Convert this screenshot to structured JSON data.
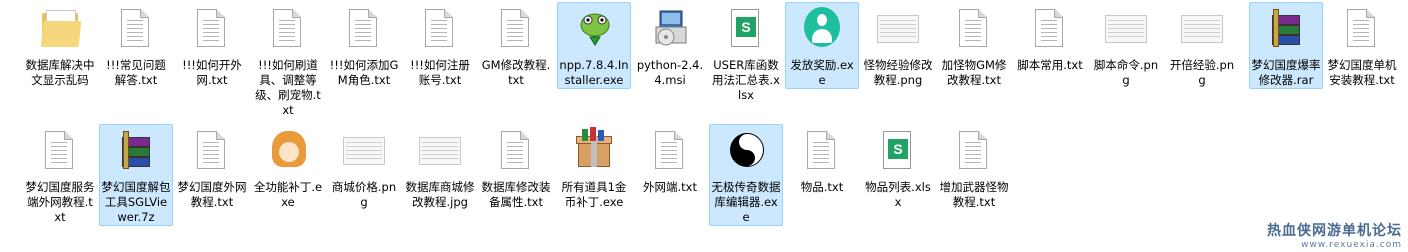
{
  "window": {
    "title": ""
  },
  "colors": {
    "selection_bg": "#cce8ff",
    "selection_border": "#99d1ff",
    "xlsx_green": "#21a366",
    "watermark": "#4a6b8f"
  },
  "files": [
    {
      "name": "数据库解决中文显示乱码",
      "icon": "folder-icon",
      "selected": false
    },
    {
      "name": "!!!常见问题解答.txt",
      "icon": "text-file-icon",
      "selected": false
    },
    {
      "name": "!!!如何开外网.txt",
      "icon": "text-file-icon",
      "selected": false
    },
    {
      "name": "!!!如何刷道具、调整等级、刷宠物.txt",
      "icon": "text-file-icon",
      "selected": false
    },
    {
      "name": "!!!如何添加GM角色.txt",
      "icon": "text-file-icon",
      "selected": false
    },
    {
      "name": "!!!如何注册账号.txt",
      "icon": "text-file-icon",
      "selected": false
    },
    {
      "name": "GM修改教程.txt",
      "icon": "text-file-icon",
      "selected": false
    },
    {
      "name": "npp.7.8.4.Installer.exe",
      "icon": "notepad-frog-icon",
      "selected": true
    },
    {
      "name": "python-2.4.4.msi",
      "icon": "installer-disc-icon",
      "selected": false
    },
    {
      "name": "USER库函数用法汇总表.xlsx",
      "icon": "excel-file-icon",
      "selected": false
    },
    {
      "name": "发放奖励.exe",
      "icon": "person-app-icon",
      "selected": true
    },
    {
      "name": "怪物经验修改教程.png",
      "icon": "image-thumbnail-icon",
      "selected": false
    },
    {
      "name": "加怪物GM修改教程.txt",
      "icon": "text-file-icon",
      "selected": false
    },
    {
      "name": "脚本常用.txt",
      "icon": "text-file-icon",
      "selected": false
    },
    {
      "name": "脚本命令.png",
      "icon": "image-thumbnail-icon",
      "selected": false
    },
    {
      "name": "开倍经验.png",
      "icon": "image-thumbnail-icon",
      "selected": false
    },
    {
      "name": "梦幻国度爆率修改器.rar",
      "icon": "winrar-archive-icon",
      "selected": true
    },
    {
      "name": "梦幻国度单机安装教程.txt",
      "icon": "text-file-icon",
      "selected": false
    },
    {
      "name": "梦幻国度服务端外网教程.txt",
      "icon": "text-file-icon",
      "selected": false
    },
    {
      "name": "梦幻国度解包工具SGLViewer.7z",
      "icon": "winrar-archive-icon",
      "selected": true
    },
    {
      "name": "梦幻国度外网教程.txt",
      "icon": "text-file-icon",
      "selected": false
    },
    {
      "name": "全功能补丁.exe",
      "icon": "anime-girl-app-icon",
      "selected": false
    },
    {
      "name": "商城价格.png",
      "icon": "image-thumbnail-icon",
      "selected": false
    },
    {
      "name": "数据库商城修改教程.jpg",
      "icon": "image-thumbnail-icon",
      "selected": false
    },
    {
      "name": "数据库修改装备属性.txt",
      "icon": "text-file-icon",
      "selected": false
    },
    {
      "name": "所有道具1金币补丁.exe",
      "icon": "treasure-box-icon",
      "selected": false
    },
    {
      "name": "外网端.txt",
      "icon": "text-file-icon",
      "selected": false
    },
    {
      "name": "无极传奇数据库编辑器.exe",
      "icon": "yin-yang-icon",
      "selected": true
    },
    {
      "name": "物品.txt",
      "icon": "text-file-icon",
      "selected": false
    },
    {
      "name": "物品列表.xlsx",
      "icon": "excel-file-icon",
      "selected": false
    },
    {
      "name": "增加武器怪物教程.txt",
      "icon": "text-file-icon",
      "selected": false
    }
  ],
  "watermark": {
    "line1": "热血侠网游单机论坛",
    "line2": "www.rexuexia.com"
  }
}
